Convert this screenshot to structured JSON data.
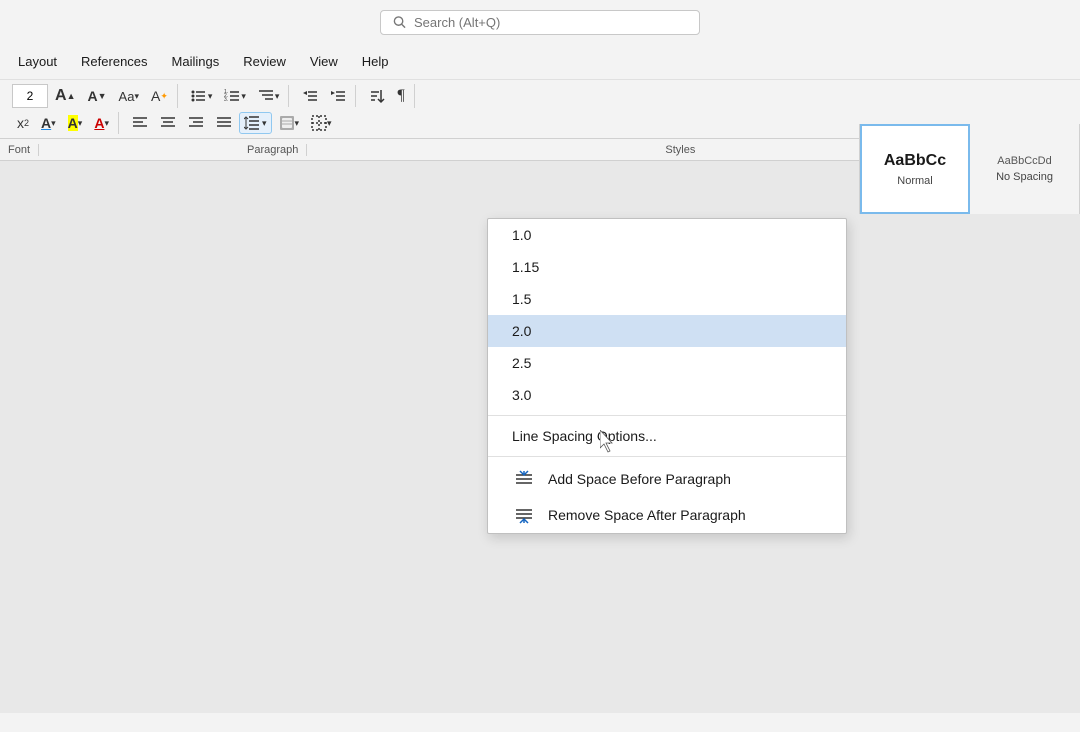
{
  "titlebar": {
    "search_placeholder": "Search (Alt+Q)"
  },
  "menubar": {
    "items": [
      "Layout",
      "References",
      "Mailings",
      "Review",
      "View",
      "Help"
    ]
  },
  "ribbon": {
    "font_size": "2",
    "grow_label": "A",
    "shrink_label": "A",
    "case_label": "Aa",
    "clear_label": "A",
    "align_left": "≡",
    "align_center": "≡",
    "align_right": "≡",
    "align_justify": "≡",
    "line_spacing_label": "≡",
    "shading_label": "▓",
    "borders_label": "▦",
    "font_section_label": "Font",
    "para_section_label": "Paragraph",
    "styles_section_label": "Styles"
  },
  "styles": {
    "normal_label": "Normal",
    "no_spacing_label": "No Spacing"
  },
  "dropdown": {
    "items": [
      {
        "value": "1.0",
        "highlighted": false
      },
      {
        "value": "1.15",
        "highlighted": false
      },
      {
        "value": "1.5",
        "highlighted": false
      },
      {
        "value": "2.0",
        "highlighted": true
      },
      {
        "value": "2.5",
        "highlighted": false
      },
      {
        "value": "3.0",
        "highlighted": false
      }
    ],
    "options_label": "Line Spacing Options...",
    "add_space_before": "Add Space Before Paragraph",
    "remove_space_after": "Remove Space After Paragraph"
  }
}
